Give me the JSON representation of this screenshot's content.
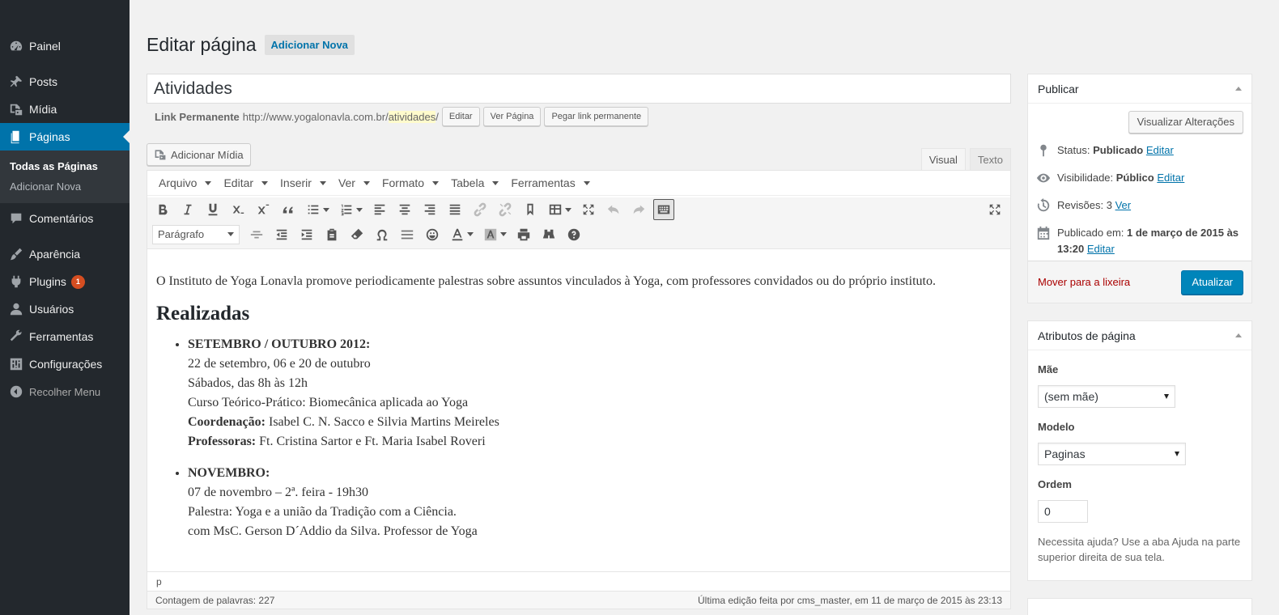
{
  "sidebar": {
    "items": [
      {
        "label": "Painel",
        "icon": "dashboard-icon"
      },
      {
        "label": "Posts",
        "icon": "pin-icon"
      },
      {
        "label": "Mídia",
        "icon": "media-icon"
      },
      {
        "label": "Páginas",
        "icon": "pages-icon"
      },
      {
        "label": "Comentários",
        "icon": "comment-icon"
      },
      {
        "label": "Aparência",
        "icon": "brush-icon"
      },
      {
        "label": "Plugins",
        "icon": "plugin-icon",
        "badge": "1"
      },
      {
        "label": "Usuários",
        "icon": "user-icon"
      },
      {
        "label": "Ferramentas",
        "icon": "wrench-icon"
      },
      {
        "label": "Configurações",
        "icon": "settings-icon"
      }
    ],
    "submenu": [
      "Todas as Páginas",
      "Adicionar Nova"
    ],
    "collapse": "Recolher Menu"
  },
  "header": {
    "title": "Editar página",
    "add_new": "Adicionar Nova"
  },
  "post": {
    "title": "Atividades",
    "permalink_label": "Link Permanente",
    "permalink_base": "http://www.yogalonavla.com.br/",
    "permalink_slug": "atividades",
    "permalink_end": "/",
    "edit_btn": "Editar",
    "view_btn": "Ver Página",
    "shortlink_btn": "Pegar link permanente"
  },
  "editor": {
    "add_media": "Adicionar Mídia",
    "tab_visual": "Visual",
    "tab_text": "Texto",
    "menus": [
      "Arquivo",
      "Editar",
      "Inserir",
      "Ver",
      "Formato",
      "Tabela",
      "Ferramentas"
    ],
    "format_select": "Parágrafo",
    "path": "p",
    "word_count": "Contagem de palavras: 227",
    "last_edit": "Última edição feita por cms_master, em 11 de março de 2015 às 23:13"
  },
  "content": {
    "intro": "O Instituto de Yoga Lonavla promove periodicamente palestras sobre assuntos vinculados à Yoga, com professores convidados ou do próprio instituto.",
    "heading": "Realizadas",
    "item1": {
      "title": "SETEMBRO / OUTUBRO 2012:",
      "line1": "22 de setembro, 06 e 20 de outubro",
      "line2": "Sábados, das 8h às 12h",
      "line3": "Curso Teórico-Prático: Biomecânica aplicada ao Yoga",
      "coord_label": "Coordenação:",
      "coord": " Isabel C. N. Sacco e Silvia Martins Meireles",
      "prof_label": "Professoras:",
      "prof": " Ft. Cristina Sartor e Ft. Maria Isabel Roveri"
    },
    "item2": {
      "title": "NOVEMBRO:",
      "line1": "07 de novembro – 2ª. feira - 19h30",
      "line2": "Palestra: Yoga e a união da Tradição com a Ciência.",
      "line3": "com MsC. Gerson D´Addio da Silva. Professor de Yoga"
    }
  },
  "publish": {
    "title": "Publicar",
    "preview": "Visualizar Alterações",
    "status_label": "Status: ",
    "status_value": "Publicado",
    "visibility_label": "Visibilidade: ",
    "visibility_value": "Público",
    "revisions_label": "Revisões: ",
    "revisions_value": "3",
    "revisions_link": "Ver",
    "published_label": "Publicado em: ",
    "published_value": "1 de março de 2015 às 13:20",
    "edit_link": "Editar",
    "trash": "Mover para a lixeira",
    "update": "Atualizar"
  },
  "attributes": {
    "title": "Atributos de página",
    "parent_label": "Mãe",
    "parent_value": "(sem mãe)",
    "template_label": "Modelo",
    "template_value": "Paginas",
    "order_label": "Ordem",
    "order_value": "0",
    "help": "Necessita ajuda? Use a aba Ajuda na parte superior direita de sua tela."
  },
  "colors": {
    "sidebar": "#23282d",
    "accent": "#0073aa",
    "update": "#0085ba",
    "trash": "#a00000"
  }
}
